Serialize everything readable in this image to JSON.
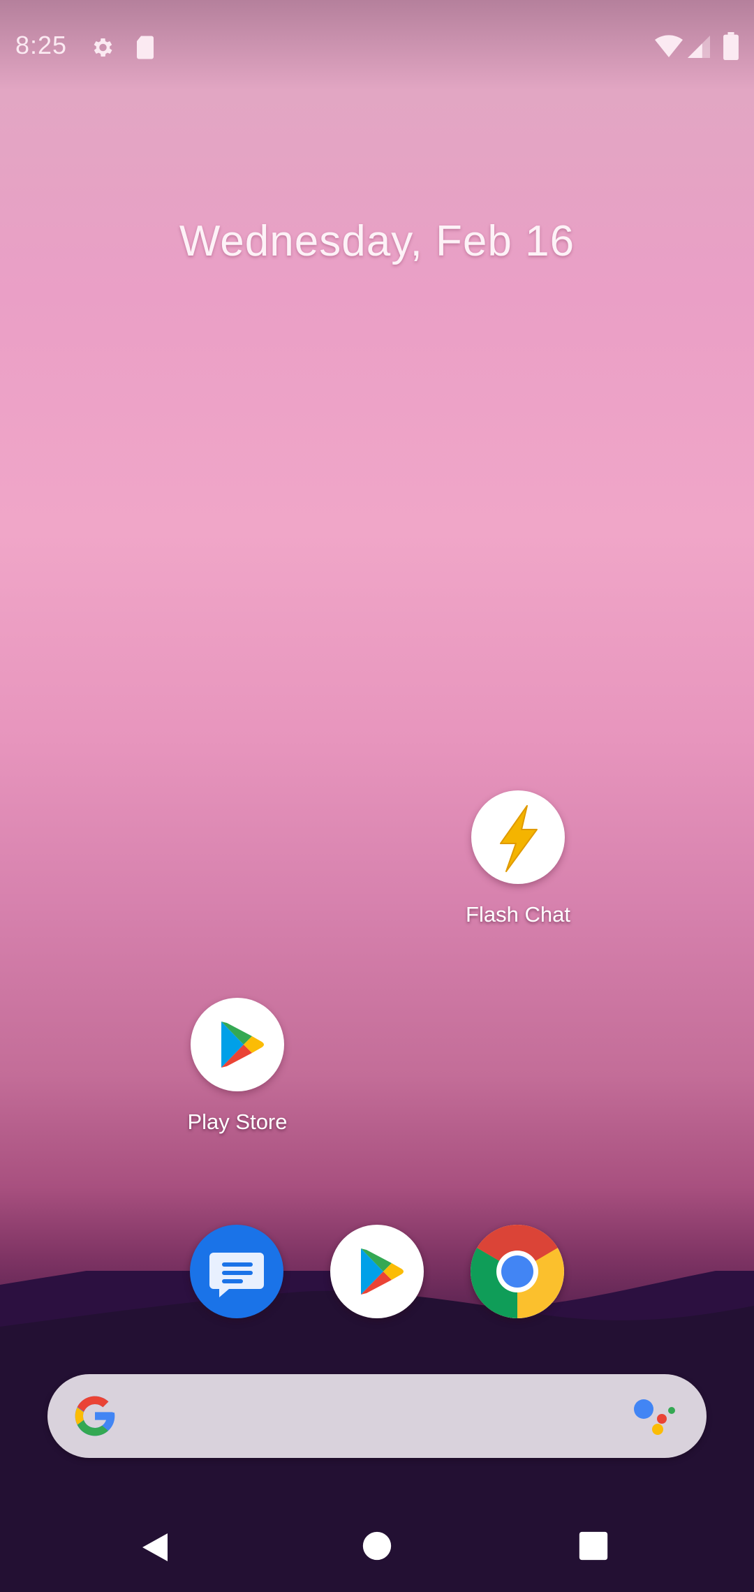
{
  "status_bar": {
    "time": "8:25",
    "icons": [
      "gear-icon",
      "sd-card-icon",
      "wifi-icon",
      "cell-signal-icon",
      "battery-icon"
    ]
  },
  "home": {
    "date": "Wednesday, Feb 16",
    "apps": [
      {
        "label": "Flash Chat",
        "icon": "lightning-bolt-icon"
      },
      {
        "label": "Play Store",
        "icon": "play-store-icon"
      }
    ]
  },
  "dock": {
    "apps": [
      "messages-icon",
      "play-store-icon",
      "chrome-icon"
    ]
  },
  "search": {
    "icons": [
      "google-g-icon",
      "google-assistant-icon"
    ]
  },
  "nav": {
    "buttons": [
      "back-button",
      "home-button",
      "recents-button"
    ]
  },
  "colors": {
    "bolt": "#f4b400",
    "messages_blue": "#1a73e8",
    "search_bg": "#d9d2dc"
  }
}
